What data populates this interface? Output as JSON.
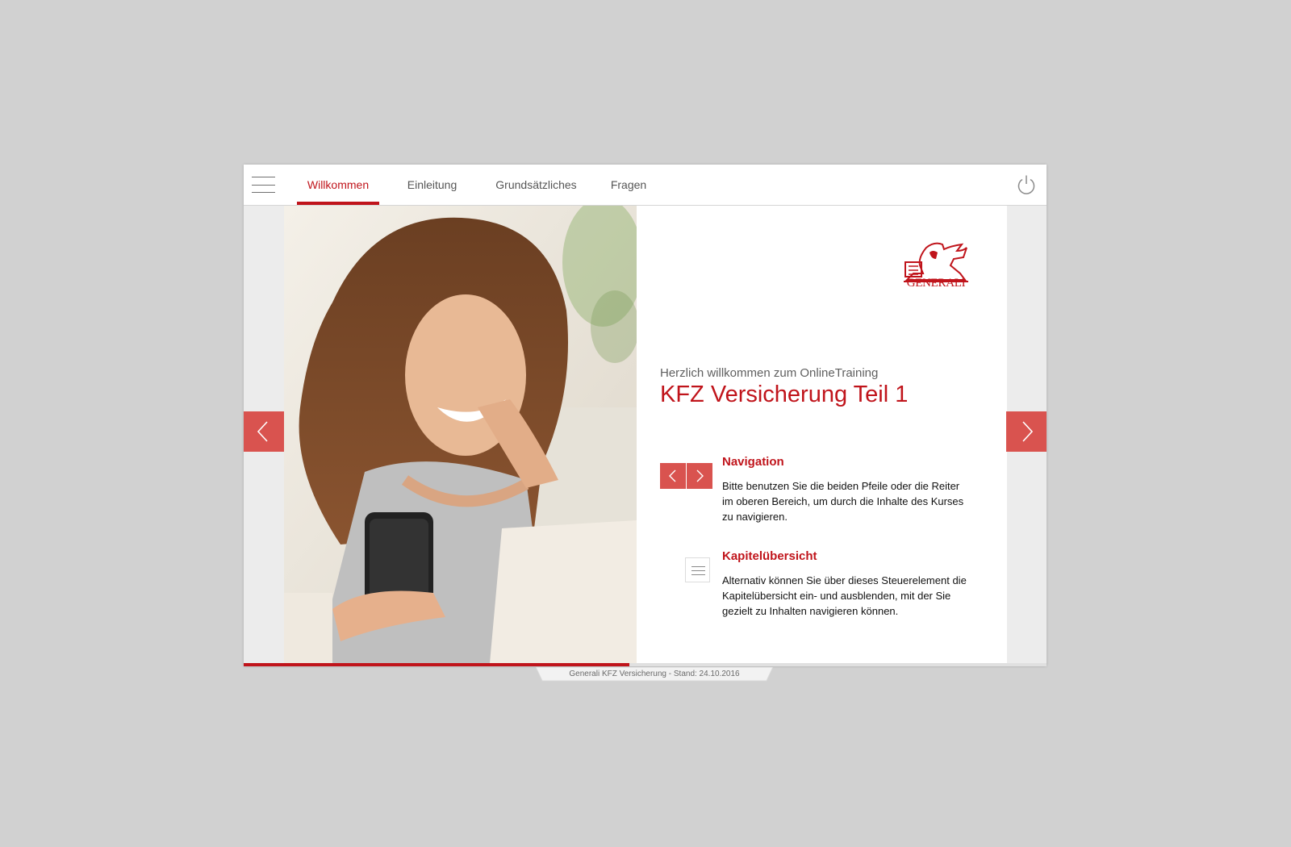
{
  "nav": {
    "tabs": [
      {
        "label": "Willkommen",
        "active": true
      },
      {
        "label": "Einleitung",
        "active": false
      },
      {
        "label": "Grundsätzliches",
        "active": false
      },
      {
        "label": "Fragen",
        "active": false
      }
    ],
    "menu_icon": "hamburger-menu-icon",
    "power_icon": "power-icon"
  },
  "main": {
    "logo_text": "GENERALI",
    "welcome_text": "Herzlich willkommen zum OnlineTraining",
    "title": "KFZ Versicherung Teil 1",
    "sections": [
      {
        "heading": "Navigation",
        "body": "Bitte benutzen Sie die beiden Pfeile oder die Reiter im oberen Bereich, um durch die Inhalte des Kurses zu navigieren.",
        "icon": "arrow-pair-icon"
      },
      {
        "heading": "Kapitelübersicht",
        "body": "Alternativ können Sie über dieses Steuerelement die Kapitelübersicht ein- und ausblenden, mit der Sie gezielt zu Inhalten navigieren können.",
        "icon": "chapter-overview-icon"
      }
    ]
  },
  "progress": {
    "fraction": 0.48
  },
  "footer": {
    "text": "Generali KFZ Versicherung - Stand: 24.10.2016"
  },
  "colors": {
    "accent": "#c0141b",
    "arrow": "#d9534f",
    "background": "#d1d1d1"
  }
}
